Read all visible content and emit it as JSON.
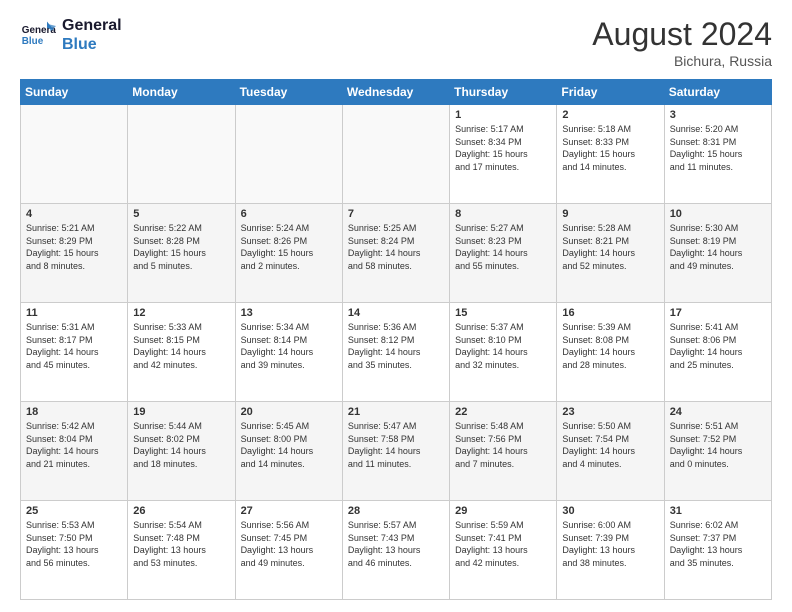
{
  "header": {
    "logo_line1": "General",
    "logo_line2": "Blue",
    "month_year": "August 2024",
    "location": "Bichura, Russia"
  },
  "days_of_week": [
    "Sunday",
    "Monday",
    "Tuesday",
    "Wednesday",
    "Thursday",
    "Friday",
    "Saturday"
  ],
  "weeks": [
    [
      {
        "day": "",
        "info": ""
      },
      {
        "day": "",
        "info": ""
      },
      {
        "day": "",
        "info": ""
      },
      {
        "day": "",
        "info": ""
      },
      {
        "day": "1",
        "info": "Sunrise: 5:17 AM\nSunset: 8:34 PM\nDaylight: 15 hours\nand 17 minutes."
      },
      {
        "day": "2",
        "info": "Sunrise: 5:18 AM\nSunset: 8:33 PM\nDaylight: 15 hours\nand 14 minutes."
      },
      {
        "day": "3",
        "info": "Sunrise: 5:20 AM\nSunset: 8:31 PM\nDaylight: 15 hours\nand 11 minutes."
      }
    ],
    [
      {
        "day": "4",
        "info": "Sunrise: 5:21 AM\nSunset: 8:29 PM\nDaylight: 15 hours\nand 8 minutes."
      },
      {
        "day": "5",
        "info": "Sunrise: 5:22 AM\nSunset: 8:28 PM\nDaylight: 15 hours\nand 5 minutes."
      },
      {
        "day": "6",
        "info": "Sunrise: 5:24 AM\nSunset: 8:26 PM\nDaylight: 15 hours\nand 2 minutes."
      },
      {
        "day": "7",
        "info": "Sunrise: 5:25 AM\nSunset: 8:24 PM\nDaylight: 14 hours\nand 58 minutes."
      },
      {
        "day": "8",
        "info": "Sunrise: 5:27 AM\nSunset: 8:23 PM\nDaylight: 14 hours\nand 55 minutes."
      },
      {
        "day": "9",
        "info": "Sunrise: 5:28 AM\nSunset: 8:21 PM\nDaylight: 14 hours\nand 52 minutes."
      },
      {
        "day": "10",
        "info": "Sunrise: 5:30 AM\nSunset: 8:19 PM\nDaylight: 14 hours\nand 49 minutes."
      }
    ],
    [
      {
        "day": "11",
        "info": "Sunrise: 5:31 AM\nSunset: 8:17 PM\nDaylight: 14 hours\nand 45 minutes."
      },
      {
        "day": "12",
        "info": "Sunrise: 5:33 AM\nSunset: 8:15 PM\nDaylight: 14 hours\nand 42 minutes."
      },
      {
        "day": "13",
        "info": "Sunrise: 5:34 AM\nSunset: 8:14 PM\nDaylight: 14 hours\nand 39 minutes."
      },
      {
        "day": "14",
        "info": "Sunrise: 5:36 AM\nSunset: 8:12 PM\nDaylight: 14 hours\nand 35 minutes."
      },
      {
        "day": "15",
        "info": "Sunrise: 5:37 AM\nSunset: 8:10 PM\nDaylight: 14 hours\nand 32 minutes."
      },
      {
        "day": "16",
        "info": "Sunrise: 5:39 AM\nSunset: 8:08 PM\nDaylight: 14 hours\nand 28 minutes."
      },
      {
        "day": "17",
        "info": "Sunrise: 5:41 AM\nSunset: 8:06 PM\nDaylight: 14 hours\nand 25 minutes."
      }
    ],
    [
      {
        "day": "18",
        "info": "Sunrise: 5:42 AM\nSunset: 8:04 PM\nDaylight: 14 hours\nand 21 minutes."
      },
      {
        "day": "19",
        "info": "Sunrise: 5:44 AM\nSunset: 8:02 PM\nDaylight: 14 hours\nand 18 minutes."
      },
      {
        "day": "20",
        "info": "Sunrise: 5:45 AM\nSunset: 8:00 PM\nDaylight: 14 hours\nand 14 minutes."
      },
      {
        "day": "21",
        "info": "Sunrise: 5:47 AM\nSunset: 7:58 PM\nDaylight: 14 hours\nand 11 minutes."
      },
      {
        "day": "22",
        "info": "Sunrise: 5:48 AM\nSunset: 7:56 PM\nDaylight: 14 hours\nand 7 minutes."
      },
      {
        "day": "23",
        "info": "Sunrise: 5:50 AM\nSunset: 7:54 PM\nDaylight: 14 hours\nand 4 minutes."
      },
      {
        "day": "24",
        "info": "Sunrise: 5:51 AM\nSunset: 7:52 PM\nDaylight: 14 hours\nand 0 minutes."
      }
    ],
    [
      {
        "day": "25",
        "info": "Sunrise: 5:53 AM\nSunset: 7:50 PM\nDaylight: 13 hours\nand 56 minutes."
      },
      {
        "day": "26",
        "info": "Sunrise: 5:54 AM\nSunset: 7:48 PM\nDaylight: 13 hours\nand 53 minutes."
      },
      {
        "day": "27",
        "info": "Sunrise: 5:56 AM\nSunset: 7:45 PM\nDaylight: 13 hours\nand 49 minutes."
      },
      {
        "day": "28",
        "info": "Sunrise: 5:57 AM\nSunset: 7:43 PM\nDaylight: 13 hours\nand 46 minutes."
      },
      {
        "day": "29",
        "info": "Sunrise: 5:59 AM\nSunset: 7:41 PM\nDaylight: 13 hours\nand 42 minutes."
      },
      {
        "day": "30",
        "info": "Sunrise: 6:00 AM\nSunset: 7:39 PM\nDaylight: 13 hours\nand 38 minutes."
      },
      {
        "day": "31",
        "info": "Sunrise: 6:02 AM\nSunset: 7:37 PM\nDaylight: 13 hours\nand 35 minutes."
      }
    ]
  ]
}
